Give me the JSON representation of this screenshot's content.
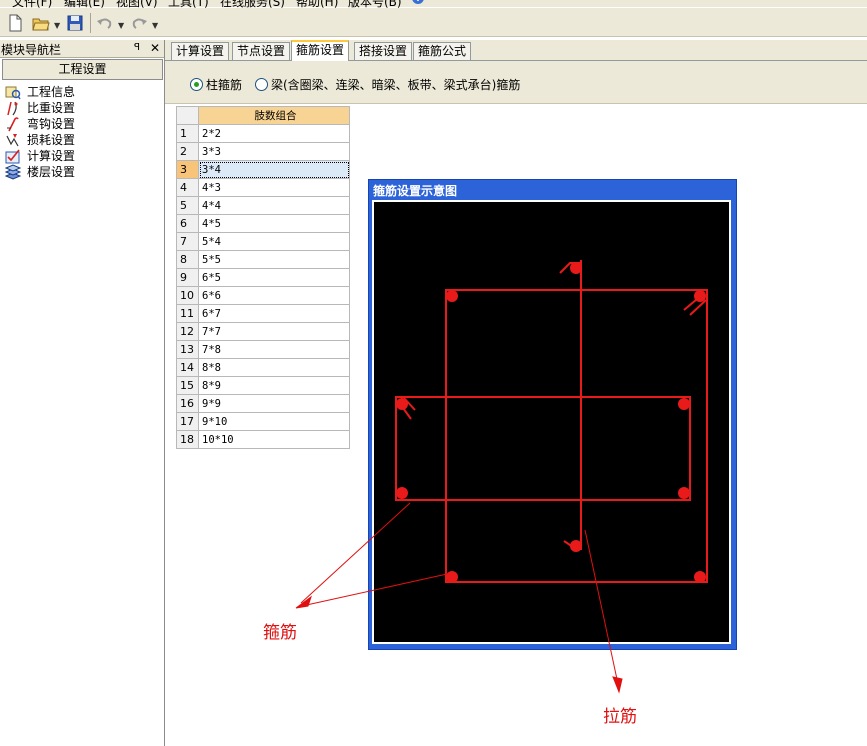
{
  "menubar": {
    "items": [
      "文件(F)",
      "编辑(E)",
      "视图(V)",
      "工具(T)",
      "在线服务(S)",
      "帮助(H)",
      "版本号(B)"
    ]
  },
  "toolbar": {
    "buttons": [
      "new-document-icon",
      "open-folder-icon",
      "save-icon",
      "undo-icon",
      "redo-icon"
    ]
  },
  "nav": {
    "title": "模块导航栏",
    "pin": "ꟼ",
    "close": "✕",
    "group_label": "工程设置",
    "items": [
      {
        "label": "工程信息",
        "icon": "project-info-icon"
      },
      {
        "label": "比重设置",
        "icon": "density-settings-icon"
      },
      {
        "label": "弯钩设置",
        "icon": "hook-settings-icon"
      },
      {
        "label": "损耗设置",
        "icon": "loss-settings-icon"
      },
      {
        "label": "计算设置",
        "icon": "calc-settings-icon"
      },
      {
        "label": "楼层设置",
        "icon": "floor-settings-icon"
      }
    ]
  },
  "tabs": [
    {
      "label": "计算设置",
      "active": false
    },
    {
      "label": "节点设置",
      "active": false
    },
    {
      "label": "箍筋设置",
      "active": true
    },
    {
      "label": "搭接设置",
      "active": false
    },
    {
      "label": "箍筋公式",
      "active": false
    }
  ],
  "radios": {
    "column": "柱箍筋",
    "beam": "梁(含圈梁、连梁、暗梁、板带、梁式承台)箍筋",
    "selected": "column"
  },
  "table": {
    "header": "肢数组合",
    "selected_row": 3,
    "rows": [
      {
        "n": "1",
        "v": "2*2"
      },
      {
        "n": "2",
        "v": "3*3"
      },
      {
        "n": "3",
        "v": "3*4"
      },
      {
        "n": "4",
        "v": "4*3"
      },
      {
        "n": "5",
        "v": "4*4"
      },
      {
        "n": "6",
        "v": "4*5"
      },
      {
        "n": "7",
        "v": "5*4"
      },
      {
        "n": "8",
        "v": "5*5"
      },
      {
        "n": "9",
        "v": "6*5"
      },
      {
        "n": "10",
        "v": "6*6"
      },
      {
        "n": "11",
        "v": "6*7"
      },
      {
        "n": "12",
        "v": "7*7"
      },
      {
        "n": "13",
        "v": "7*8"
      },
      {
        "n": "14",
        "v": "8*8"
      },
      {
        "n": "15",
        "v": "8*9"
      },
      {
        "n": "16",
        "v": "9*9"
      },
      {
        "n": "17",
        "v": "9*10"
      },
      {
        "n": "18",
        "v": "10*10"
      }
    ]
  },
  "diagram": {
    "title": "箍筋设置示意图"
  },
  "annotations": {
    "stirrup": "箍筋",
    "tie_bar": "拉筋"
  },
  "colors": {
    "rebar": "#e81a1a",
    "annotation": "#e01010",
    "title_bar": "#2d63d8"
  }
}
